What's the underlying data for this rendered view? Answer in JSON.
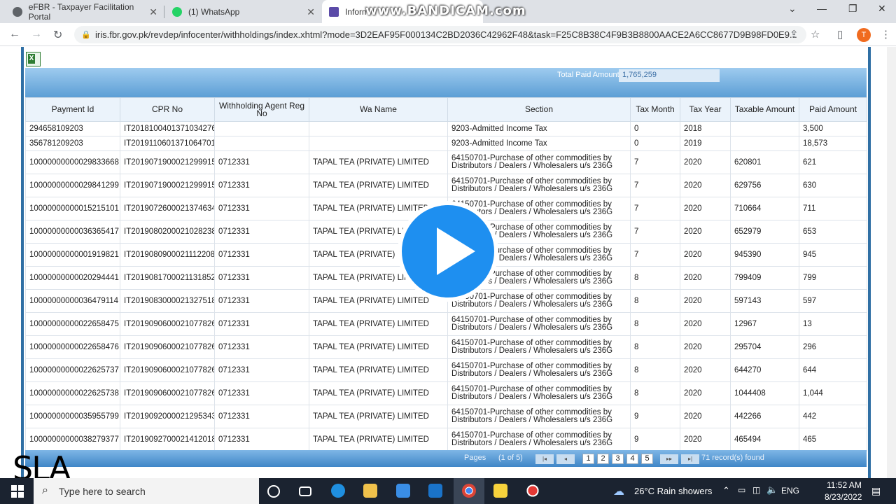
{
  "browser": {
    "tabs": [
      {
        "label": "eFBR - Taxpayer Facilitation Portal"
      },
      {
        "label": "(1) WhatsApp"
      },
      {
        "label": "Inform"
      }
    ],
    "url": "iris.fbr.gov.pk/revdep/infocenter/withholdings/index.xhtml?mode=3D2EAF95F000134C2BD2036C42962F48&task=F25C8B38C4F9B3B8800AACE2A6CC8677D9B98FD0E9...",
    "profile_initial": "T"
  },
  "watermark": "www.BANDICAM.com",
  "overlay": "SLA",
  "summary": {
    "total_paid_label": "Total Paid Amount",
    "total_paid_value": "1,765,259"
  },
  "table": {
    "headers": [
      "Payment Id",
      "CPR No",
      "Withholding Agent Reg No",
      "Wa Name",
      "Section",
      "Tax Month",
      "Tax Year",
      "Taxable Amount",
      "Paid Amount"
    ],
    "rows": [
      [
        "294658109203",
        "IT20181004013710342​76",
        "",
        "",
        "9203-Admitted Income Tax",
        "0",
        "2018",
        "",
        "3,500"
      ],
      [
        "356781209203",
        "IT20191106013710647​01",
        "",
        "",
        "9203-Admitted Income Tax",
        "0",
        "2019",
        "",
        "18,573"
      ],
      [
        "10000000000029833668",
        "IT20190719000212999​15",
        "0712331",
        "TAPAL TEA (PRIVATE) LIMITED",
        "64150701-Purchase of other commodities by Distributors / Dealers / Wholesalers u/s 236G",
        "7",
        "2020",
        "620801",
        "621"
      ],
      [
        "10000000000029841299",
        "IT20190719000212999​15",
        "0712331",
        "TAPAL TEA (PRIVATE) LIMITED",
        "64150701-Purchase of other commodities by Distributors / Dealers / Wholesalers u/s 236G",
        "7",
        "2020",
        "629756",
        "630"
      ],
      [
        "10000000000015215101",
        "IT20190726000213746​34",
        "0712331",
        "TAPAL TEA (PRIVATE) LIMITED",
        "64150701-Purchase of other commodities by Distributors / Dealers / Wholesalers u/s 236G",
        "7",
        "2020",
        "710664",
        "711"
      ],
      [
        "10000000000036365417",
        "IT20190802000210282​38",
        "0712331",
        "TAPAL TEA (PRIVATE) LIMITED",
        "64150701-Purchase of other commodities by Distributors / Dealers / Wholesalers u/s 236G",
        "7",
        "2020",
        "652979",
        "653"
      ],
      [
        "10000000000001919821",
        "IT20190809000211122​08",
        "0712331",
        "TAPAL TEA (PRIVATE) LIMITED",
        "64150701-Purchase of other commodities by Distributors / Dealers / Wholesalers u/s 236G",
        "7",
        "2020",
        "945390",
        "945"
      ],
      [
        "10000000000020294441",
        "IT20190817000211318​52",
        "0712331",
        "TAPAL TEA (PRIVATE) LIMITED",
        "64150701-Purchase of other commodities by Distributors / Dealers / Wholesalers u/s 236G",
        "8",
        "2020",
        "799409",
        "799"
      ],
      [
        "10000000000036479114",
        "IT20190830000213275​18",
        "0712331",
        "TAPAL TEA (PRIVATE) LIMITED",
        "64150701-Purchase of other commodities by Distributors / Dealers / Wholesalers u/s 236G",
        "8",
        "2020",
        "597143",
        "597"
      ],
      [
        "10000000000022658475",
        "IT20190906000210778​26",
        "0712331",
        "TAPAL TEA (PRIVATE) LIMITED",
        "64150701-Purchase of other commodities by Distributors / Dealers / Wholesalers u/s 236G",
        "8",
        "2020",
        "12967",
        "13"
      ],
      [
        "10000000000022658476",
        "IT20190906000210778​26",
        "0712331",
        "TAPAL TEA (PRIVATE) LIMITED",
        "64150701-Purchase of other commodities by Distributors / Dealers / Wholesalers u/s 236G",
        "8",
        "2020",
        "295704",
        "296"
      ],
      [
        "10000000000022625737",
        "IT20190906000210778​26",
        "0712331",
        "TAPAL TEA (PRIVATE) LIMITED",
        "64150701-Purchase of other commodities by Distributors / Dealers / Wholesalers u/s 236G",
        "8",
        "2020",
        "644270",
        "644"
      ],
      [
        "10000000000022625738",
        "IT20190906000210778​26",
        "0712331",
        "TAPAL TEA (PRIVATE) LIMITED",
        "64150701-Purchase of other commodities by Distributors / Dealers / Wholesalers u/s 236G",
        "8",
        "2020",
        "1044408",
        "1,044"
      ],
      [
        "10000000000035955799",
        "IT20190920000212953​43",
        "0712331",
        "TAPAL TEA (PRIVATE) LIMITED",
        "64150701-Purchase of other commodities by Distributors / Dealers / Wholesalers u/s 236G",
        "9",
        "2020",
        "442266",
        "442"
      ],
      [
        "10000000000038279377",
        "IT20190927000214120​18",
        "0712331",
        "TAPAL TEA (PRIVATE) LIMITED",
        "64150701-Purchase of other commodities by Distributors / Dealers / Wholesalers u/s 236G",
        "9",
        "2020",
        "465494",
        "465"
      ]
    ]
  },
  "pager": {
    "label": "Pages",
    "of": "(1 of 5)",
    "pages": [
      "1",
      "2",
      "3",
      "4",
      "5"
    ],
    "records": "71 record(s) found"
  },
  "taskbar": {
    "search_placeholder": "Type here to search",
    "weather": "26°C  Rain showers",
    "lang": "ENG",
    "time": "11:52 AM",
    "date": "8/23/2022"
  }
}
